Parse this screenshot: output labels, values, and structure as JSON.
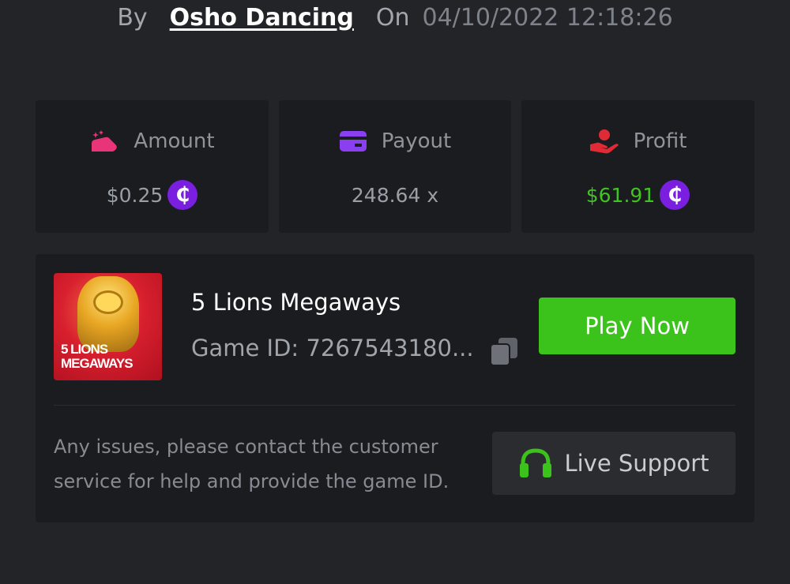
{
  "header": {
    "by_label": "By",
    "username": "Osho Dancing",
    "on_label": "On",
    "datetime": "04/10/2022 12:18:26"
  },
  "stats": {
    "amount": {
      "label": "Amount",
      "value": "$0.25",
      "icon": "bet-amount-icon",
      "icon_color": "#e8357a"
    },
    "payout": {
      "label": "Payout",
      "value": "248.64 x",
      "icon": "card-icon",
      "icon_color": "#8a3ff0"
    },
    "profit": {
      "label": "Profit",
      "value": "$61.91",
      "icon": "hand-coin-icon",
      "icon_color": "#e02a36",
      "value_color": "#3fc422"
    },
    "currency_symbol": "₵"
  },
  "game": {
    "title": "5 Lions Megaways",
    "id_label": "Game ID:",
    "id_value": "7267543180...",
    "thumb_line1": "5 LIONS",
    "thumb_line2": "MEGAWAYS",
    "play_label": "Play Now"
  },
  "support": {
    "help_text": "Any issues, please contact the customer service for help and provide the game ID.",
    "button_label": "Live Support"
  },
  "colors": {
    "background": "#232427",
    "card": "#1b1c1f",
    "accent_green": "#3bc31c",
    "coin_purple": "#7a1fe0"
  }
}
